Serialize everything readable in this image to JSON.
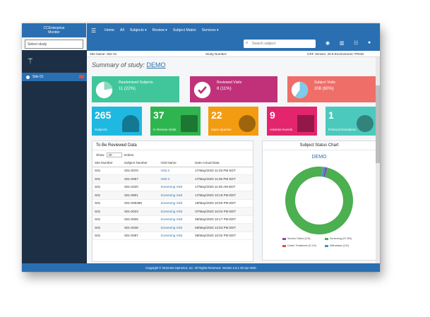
{
  "app": {
    "brand_line1": "CCEnterprise",
    "brand_line2": "Monitor",
    "sidebar_search_placeholder": "Select study",
    "sidebar_site": "Site 01"
  },
  "topnav": [
    {
      "label": "Home"
    },
    {
      "label": "All"
    },
    {
      "label": "Subjects ▾"
    },
    {
      "label": "Review ▾"
    },
    {
      "label": "Subject Matrix"
    },
    {
      "label": "Services ▾"
    }
  ],
  "top_search_placeholder": "Search subject",
  "infostrip": {
    "site": "Site Name: Site 01",
    "study": "Study Number:",
    "version": "CRF Version: 20.8  Environment: PROD"
  },
  "summary": {
    "prefix": "Summary of study:",
    "study": "DEMO"
  },
  "big_cards": [
    {
      "label": "Randomized Subjects",
      "value": "11 (22%)",
      "color": "#40c69a",
      "fill": 0.22
    },
    {
      "label": "Reviewed Visits",
      "value": "8 (11%)",
      "color": "#c0317a"
    },
    {
      "label": "Subject Visits",
      "value": "208 (60%)",
      "color": "#ef6e68",
      "fill": 0.6
    }
  ],
  "small_cards": [
    {
      "num": "265",
      "label": "Subjects",
      "color": "#1fb8e0"
    },
    {
      "num": "37",
      "label": "In Review Visits",
      "color": "#2eb54f"
    },
    {
      "num": "22",
      "label": "Open Queries",
      "color": "#f39c12"
    },
    {
      "num": "9",
      "label": "Adverse Events",
      "color": "#e3256d"
    },
    {
      "num": "1",
      "label": "Protocol Deviations",
      "color": "#4cc9bd"
    }
  ],
  "table_panel": {
    "title": "To Be Reviewed Data",
    "show_label": "Show",
    "show_value": "20",
    "entries_label": "entries",
    "columns": [
      "Site Number",
      "Subject Number",
      "Visit Name",
      "Date Actual Data"
    ],
    "rows": [
      [
        "S01",
        "S01-0076",
        "Visit 3",
        "17/May/2020 11:03 PM EDT"
      ],
      [
        "S01",
        "S01-0057",
        "Visit 3",
        "17/May/2020 11:05 PM EDT"
      ],
      [
        "S01",
        "S01-0320",
        "Screening Visit",
        "17/May/2020 11:00 AM EDT"
      ],
      [
        "S01",
        "S01-0801",
        "Screening Visit",
        "17/May/2020 10:19 PM EDT"
      ],
      [
        "S01",
        "S01-005396",
        "Screening Visit",
        "16/May/2020 10:50 PM EDT"
      ],
      [
        "S01",
        "S01-0023",
        "Screening Visit",
        "07/May/2020 10:04 PM EDT"
      ],
      [
        "S01",
        "S01-0005",
        "Screening Visit",
        "06/May/2020 10:17 PM EDT"
      ],
      [
        "S01",
        "S01-0046",
        "Screening Visit",
        "06/May/2020 12:53 PM EDT"
      ],
      [
        "S01",
        "S01-0097",
        "Screening Visit",
        "06/May/2020 10:02 PM EDT"
      ]
    ]
  },
  "chart_panel": {
    "title": "Subject Status Chart",
    "subtitle": "DEMO"
  },
  "chart_data": {
    "type": "pie",
    "title": "DEMO",
    "series": [
      {
        "name": "Screen Failed (1%)",
        "value": 1,
        "color": "#8e44ad"
      },
      {
        "name": "Screening (97.8%)",
        "value": 97.8,
        "color": "#4caf50"
      },
      {
        "name": "Under Treatment (0.1%)",
        "value": 0.1,
        "color": "#e74c3c"
      },
      {
        "name": "Withdrawn (1%)",
        "value": 1.1,
        "color": "#3498db"
      }
    ]
  },
  "footer": "Copyright © 2019 Bio-Optronics, Inc. All Rights Reserved. Version 2.5.1  30 Apr 2020"
}
